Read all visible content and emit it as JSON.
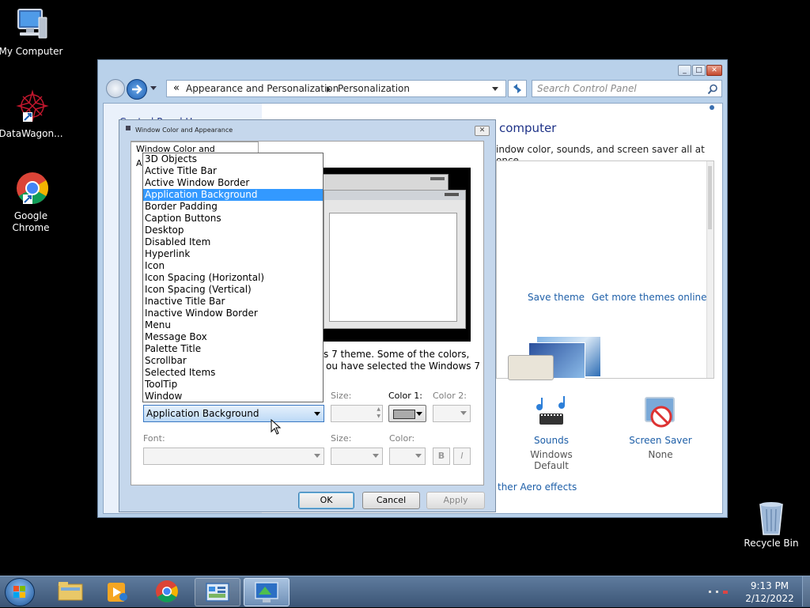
{
  "desktop": {
    "icons": [
      {
        "label_line1": "My Computer",
        "label_line2": ""
      },
      {
        "label_line1": "DataWagon...",
        "label_line2": ""
      },
      {
        "label_line1": "Google",
        "label_line2": "Chrome"
      },
      {
        "label_line1": "Recycle Bin",
        "label_line2": ""
      }
    ]
  },
  "control_panel": {
    "breadcrumb": [
      "Appearance and Personalization",
      "Personalization"
    ],
    "breadcrumb_prefix": "«",
    "search_placeholder": "Search Control Panel",
    "left_pane_partial": "Control Panel Home",
    "heading_partial": "computer",
    "subtitle_partial": "indow color, sounds, and screen saver all at once.",
    "links": {
      "save_theme": "Save theme",
      "get_more_themes": "Get more themes online"
    },
    "sounds": {
      "label": "Sounds",
      "value": "Windows Default"
    },
    "screen_saver": {
      "label": "Screen Saver",
      "value": "None"
    },
    "aero_partial": "ther Aero effects"
  },
  "dialog": {
    "title": "Window Color and Appearance",
    "tab_label": "Window Color and Appearance",
    "desc_line1": "s 7 theme.  Some of the colors,",
    "desc_line2": "ou have selected the Windows 7",
    "item_value": "Application Background",
    "size_label": "Size:",
    "color1_label": "Color 1:",
    "color2_label": "Color 2:",
    "font_label": "Font:",
    "font_size_label": "Size:",
    "font_color_label": "Color:",
    "bold_label": "B",
    "italic_label": "I",
    "ok_label": "OK",
    "cancel_label": "Cancel",
    "apply_label": "Apply",
    "dropdown_items": [
      "3D Objects",
      "Active Title Bar",
      "Active Window Border",
      "Application Background",
      "Border Padding",
      "Caption Buttons",
      "Desktop",
      "Disabled Item",
      "Hyperlink",
      "Icon",
      "Icon Spacing (Horizontal)",
      "Icon Spacing (Vertical)",
      "Inactive Title Bar",
      "Inactive Window Border",
      "Menu",
      "Message Box",
      "Palette Title",
      "Scrollbar",
      "Selected Items",
      "ToolTip",
      "Window"
    ],
    "selected_index": 3
  },
  "taskbar": {
    "time": "9:13 PM",
    "date": "2/12/2022"
  },
  "colors": {
    "selection": "#3399ff",
    "link": "#1e5fa8",
    "heading": "#1e3287"
  }
}
